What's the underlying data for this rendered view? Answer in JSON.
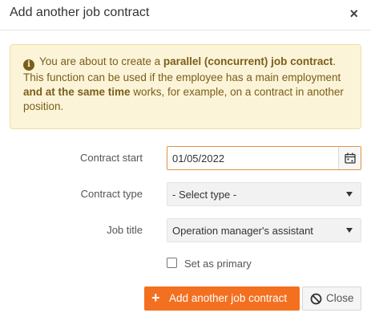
{
  "dialog": {
    "title": "Add another job contract",
    "close_glyph": "×"
  },
  "alert": {
    "icon": "info-icon",
    "text_1": "You are about to create a ",
    "text_bold_1": "parallel (concurrent) job contract",
    "text_2": ".",
    "text_3": "This function can be used if the employee has a main employment ",
    "text_bold_2": "and at the same time",
    "text_4": " works, for example, on a contract in another position.",
    "colors": {
      "background": "#fcf4d8",
      "text": "#7a5e1a"
    }
  },
  "form": {
    "contract_start": {
      "label": "Contract start",
      "value": "01/05/2022",
      "icon": "calendar-icon"
    },
    "contract_type": {
      "label": "Contract type",
      "value": "- Select type -"
    },
    "job_title": {
      "label": "Job title",
      "value": "Operation manager's assistant"
    },
    "set_as_primary": {
      "label": "Set as primary",
      "checked": false
    }
  },
  "buttons": {
    "add": {
      "icon": "plus-icon",
      "label": "Add another job contract",
      "color": "#f37020"
    },
    "close": {
      "icon": "ban-icon",
      "label": "Close"
    }
  }
}
